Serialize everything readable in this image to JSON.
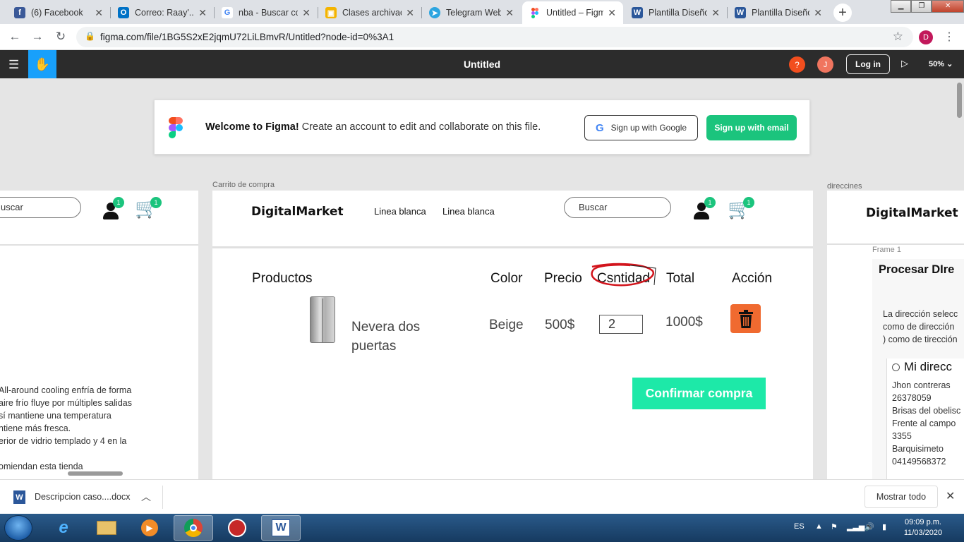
{
  "browser": {
    "tabs": [
      {
        "label": "(6) Facebook",
        "icon": "facebook-icon",
        "color": "#3b5998",
        "glyph": "f",
        "active": false
      },
      {
        "label": "Correo: Raay'.. L",
        "icon": "outlook-icon",
        "color": "#0072c6",
        "glyph": "O",
        "active": false
      },
      {
        "label": "nba - Buscar co",
        "icon": "google-icon",
        "color": "#ffffff",
        "glyph": "G",
        "active": false
      },
      {
        "label": "Clases archivad",
        "icon": "classroom-icon",
        "color": "#f4b400",
        "glyph": "▣",
        "active": false
      },
      {
        "label": "Telegram Web",
        "icon": "telegram-icon",
        "color": "#2ca5e0",
        "glyph": "➤",
        "active": false
      },
      {
        "label": "Untitled – Figm",
        "icon": "figma-icon",
        "color": "#ffffff",
        "glyph": "F",
        "active": true
      },
      {
        "label": "Plantilla Diseño",
        "icon": "word-icon",
        "color": "#2b579a",
        "glyph": "W",
        "active": false
      },
      {
        "label": "Plantilla Diseño",
        "icon": "word-icon",
        "color": "#2b579a",
        "glyph": "W",
        "active": false
      }
    ],
    "url": "figma.com/file/1BG5S2xE2jqmU72LiLBmvR/Untitled?node-id=0%3A1",
    "profile_initial": "D"
  },
  "figma": {
    "doc_title": "Untitled",
    "help": "?",
    "user_initial": "J",
    "login_label": "Log in",
    "zoom": "50%",
    "banner": {
      "bold": "Welcome to Figma!",
      "text": " Create an account to edit and collaborate on this file.",
      "google_btn": "Sign up with Google",
      "email_btn": "Sign up with email"
    }
  },
  "frames": {
    "left": {
      "search": "uscar",
      "user_badge": "1",
      "cart_badge": "1",
      "description": "All-around cooling enfría de forma\naire frío fluye por múltiples salidas\nsí mantiene una temperatura\nntiene más fresca.\nerior de vidrio templado y 4 en la\n\nomiendan esta tienda"
    },
    "cart": {
      "label": "Carrito de compra",
      "brand": "DigitalMarket",
      "nav": [
        "Linea blanca",
        "Linea blanca"
      ],
      "search": "Buscar",
      "user_badge": "1",
      "cart_badge": "1",
      "headers": {
        "productos": "Productos",
        "color": "Color",
        "precio": "Precio",
        "cantidad": "Csntidad",
        "total": "Total",
        "accion": "Acción"
      },
      "item": {
        "name_line1": "Nevera dos",
        "name_line2": "puertas",
        "color": "Beige",
        "price": "500$",
        "qty": "2",
        "total": "1000$"
      },
      "confirm": "Confirmar compra"
    },
    "right": {
      "label": "direccines",
      "brand": "DigitalMarket",
      "sublabel": "Frame 1",
      "title": "Procesar DIre",
      "info": [
        "La dirección selecc",
        "como de dirección",
        ") como de tirección"
      ],
      "radio_label": "Mi direcc",
      "address": [
        "Jhon contreras",
        "26378059",
        "Brisas del obelisc",
        "Frente al campo",
        "3355",
        "Barquisimeto",
        "04149568372"
      ]
    }
  },
  "downloads": {
    "file": "Descripcion caso....docx",
    "show_all": "Mostrar todo"
  },
  "taskbar": {
    "lang": "ES",
    "time": "09:09 p.m.",
    "date": "11/03/2020"
  },
  "colors": {
    "figma_green": "#1bc47d",
    "confirm_green": "#1de9a8",
    "trash_orange": "#f06a30",
    "figma_blue": "#18a0fb"
  }
}
